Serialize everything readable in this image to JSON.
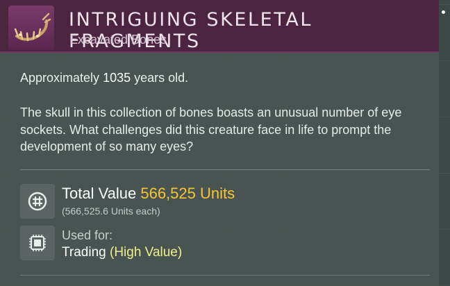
{
  "item": {
    "title": "INTRIGUING SKELETAL FRAGMENTS",
    "subtitle": "Excavated Bones",
    "icon": "skeletal-fragments-icon"
  },
  "details": {
    "age_prefix": "Approximately",
    "age_value": "1035",
    "age_suffix": "years old.",
    "description": "The skull in this collection of bones boasts an unusual number of eye sockets. What challenges did this creature face in life to prompt the development of so many eyes?"
  },
  "value": {
    "label": "Total Value",
    "amount": "566,525 Units",
    "each": "(566,525.6 Units each)",
    "icon": "units-currency-icon"
  },
  "usage": {
    "label": "Used for:",
    "category": "Trading",
    "qualifier": "(High Value)",
    "icon": "trading-chip-icon"
  },
  "colors": {
    "header_bg": "#4b2440",
    "value_accent": "#f6c634",
    "qualifier_accent": "#f0f08a"
  }
}
